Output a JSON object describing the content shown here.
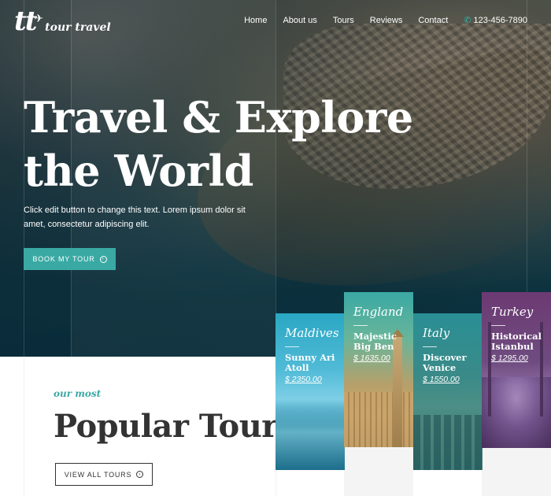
{
  "header": {
    "logo_mark": "tt",
    "logo_text": "tour travel",
    "nav": [
      "Home",
      "About us",
      "Tours",
      "Reviews",
      "Contact"
    ],
    "phone": "123-456-7890"
  },
  "hero": {
    "title_line1": "Travel & Explore",
    "title_line2": "the World",
    "description": "Click edit button to change this text. Lorem ipsum dolor sit amet, consectetur adipiscing elit.",
    "cta_label": "BOOK MY TOUR"
  },
  "popular": {
    "subtitle": "our most",
    "title": "Popular Tours",
    "cta_label": "VIEW ALL TOURS"
  },
  "tours": [
    {
      "country": "Maldives",
      "name": "Sunny Ari Atoll",
      "price": "$ 2350.00"
    },
    {
      "country": "England",
      "name": "Majestic Big Ben",
      "price": "$ 1635.00"
    },
    {
      "country": "Italy",
      "name": "Discover Venice",
      "price": "$ 1550.00"
    },
    {
      "country": "Turkey",
      "name": "Historical Istanbul",
      "price": "$ 1295.00"
    }
  ],
  "colors": {
    "accent": "#3aa9a4",
    "heading_dark": "#333333"
  }
}
